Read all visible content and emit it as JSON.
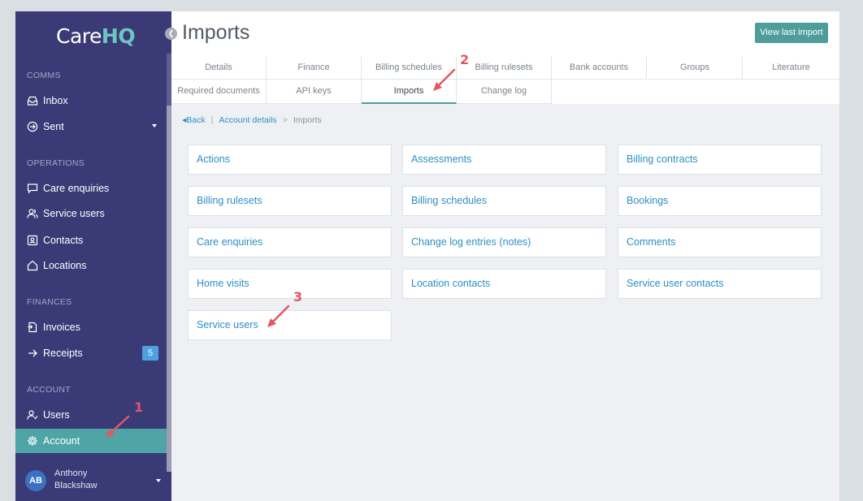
{
  "logo": {
    "care": "Care",
    "hq": "HQ"
  },
  "sidebar": {
    "sections": {
      "comms": "COMMS",
      "operations": "OPERATIONS",
      "finances": "FINANCES",
      "account": "ACCOUNT"
    },
    "items": {
      "inbox": "Inbox",
      "sent": "Sent",
      "care_enquiries": "Care enquiries",
      "service_users": "Service users",
      "contacts": "Contacts",
      "locations": "Locations",
      "invoices": "Invoices",
      "receipts": "Receipts",
      "receipts_badge": "5",
      "users": "Users",
      "account": "Account"
    },
    "user": {
      "initials": "AB",
      "first": "Anthony",
      "last": "Blackshaw"
    }
  },
  "header": {
    "title": "Imports",
    "view_last_import": "View last import"
  },
  "tabs": {
    "details": "Details",
    "finance": "Finance",
    "billing_schedules": "Billing schedules",
    "billing_rulesets": "Billing rulesets",
    "bank_accounts": "Bank accounts",
    "groups": "Groups",
    "literature": "Literature",
    "required_documents": "Required documents",
    "api_keys": "API keys",
    "imports": "Imports",
    "change_log": "Change log"
  },
  "breadcrumb": {
    "back": "Back",
    "sep": "|",
    "account_details": "Account details",
    "gt": ">",
    "current": "Imports"
  },
  "cards": {
    "actions": "Actions",
    "assessments": "Assessments",
    "billing_contracts": "Billing contracts",
    "billing_rulesets": "Billing rulesets",
    "billing_schedules": "Billing schedules",
    "bookings": "Bookings",
    "care_enquiries": "Care enquiries",
    "change_log_entries": "Change log entries (notes)",
    "comments": "Comments",
    "home_visits": "Home visits",
    "location_contacts": "Location contacts",
    "service_user_contacts": "Service user contacts",
    "service_users": "Service users"
  },
  "annotations": {
    "one": "1",
    "two": "2",
    "three": "3"
  },
  "colors": {
    "sidebar": "#3a3b76",
    "accent": "#4f9d9a",
    "link": "#2d8fc4",
    "annotation": "#e25863"
  }
}
